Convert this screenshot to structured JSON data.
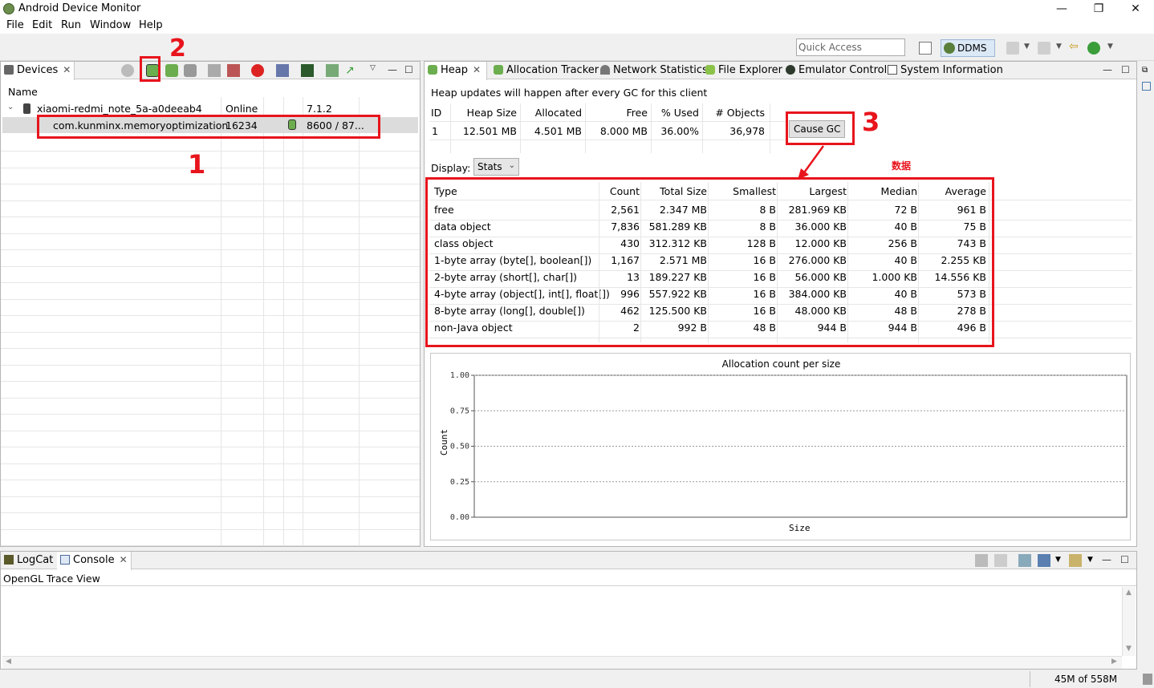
{
  "window": {
    "title": "Android Device Monitor",
    "minimize": "—",
    "restore": "❐",
    "close": "✕"
  },
  "menu": [
    "File",
    "Edit",
    "Run",
    "Window",
    "Help"
  ],
  "toolbar": {
    "quick_access_placeholder": "Quick Access",
    "perspective": "DDMS"
  },
  "devices_panel": {
    "tab": "Devices",
    "column_name": "Name",
    "device": {
      "name": "xiaomi-redmi_note_5a-a0deeab4",
      "status": "Online",
      "version": "7.1.2"
    },
    "process": {
      "name": "com.kunminx.memoryoptimization",
      "pid": "16234",
      "port": "8600 / 87..."
    }
  },
  "tabs": [
    "Heap",
    "Allocation Tracker",
    "Network Statistics",
    "File Explorer",
    "Emulator Control",
    "System Information"
  ],
  "heap": {
    "notice": "Heap updates will happen after every GC for this client",
    "summary_headers": [
      "ID",
      "Heap Size",
      "Allocated",
      "Free",
      "% Used",
      "# Objects"
    ],
    "summary_row": [
      "1",
      "12.501 MB",
      "4.501 MB",
      "8.000 MB",
      "36.00%",
      "36,978"
    ],
    "cause_gc": "Cause GC",
    "display_label": "Display:",
    "display_value": "Stats",
    "stats_headers": [
      "Type",
      "Count",
      "Total Size",
      "Smallest",
      "Largest",
      "Median",
      "Average"
    ],
    "stats_rows": [
      [
        "free",
        "2,561",
        "2.347 MB",
        "8 B",
        "281.969 KB",
        "72 B",
        "961 B"
      ],
      [
        "data object",
        "7,836",
        "581.289 KB",
        "8 B",
        "36.000 KB",
        "40 B",
        "75 B"
      ],
      [
        "class object",
        "430",
        "312.312 KB",
        "128 B",
        "12.000 KB",
        "256 B",
        "743 B"
      ],
      [
        "1-byte array (byte[], boolean[])",
        "1,167",
        "2.571 MB",
        "16 B",
        "276.000 KB",
        "40 B",
        "2.255 KB"
      ],
      [
        "2-byte array (short[], char[])",
        "13",
        "189.227 KB",
        "16 B",
        "56.000 KB",
        "1.000 KB",
        "14.556 KB"
      ],
      [
        "4-byte array (object[], int[], float[])",
        "996",
        "557.922 KB",
        "16 B",
        "384.000 KB",
        "40 B",
        "573 B"
      ],
      [
        "8-byte array (long[], double[])",
        "462",
        "125.500 KB",
        "16 B",
        "48.000 KB",
        "48 B",
        "278 B"
      ],
      [
        "non-Java object",
        "2",
        "992 B",
        "48 B",
        "944 B",
        "944 B",
        "496 B"
      ]
    ]
  },
  "chart_data": {
    "type": "bar",
    "title": "Allocation count per size",
    "xlabel": "Size",
    "ylabel": "Count",
    "yticks": [
      "0.00",
      "0.25",
      "0.50",
      "0.75",
      "1.00"
    ],
    "ylim": [
      0,
      1
    ],
    "grid": true,
    "categories": [],
    "values": []
  },
  "annotations": {
    "one": "1",
    "two": "2",
    "three": "3",
    "data_label": "数据"
  },
  "bottom_panel": {
    "tabs": [
      "LogCat",
      "Console"
    ],
    "view_title": "OpenGL Trace View"
  },
  "status": {
    "memory": "45M of 558M"
  },
  "colors": {
    "annotation_red": "#e8141c",
    "selection": "#dcdcdc"
  }
}
